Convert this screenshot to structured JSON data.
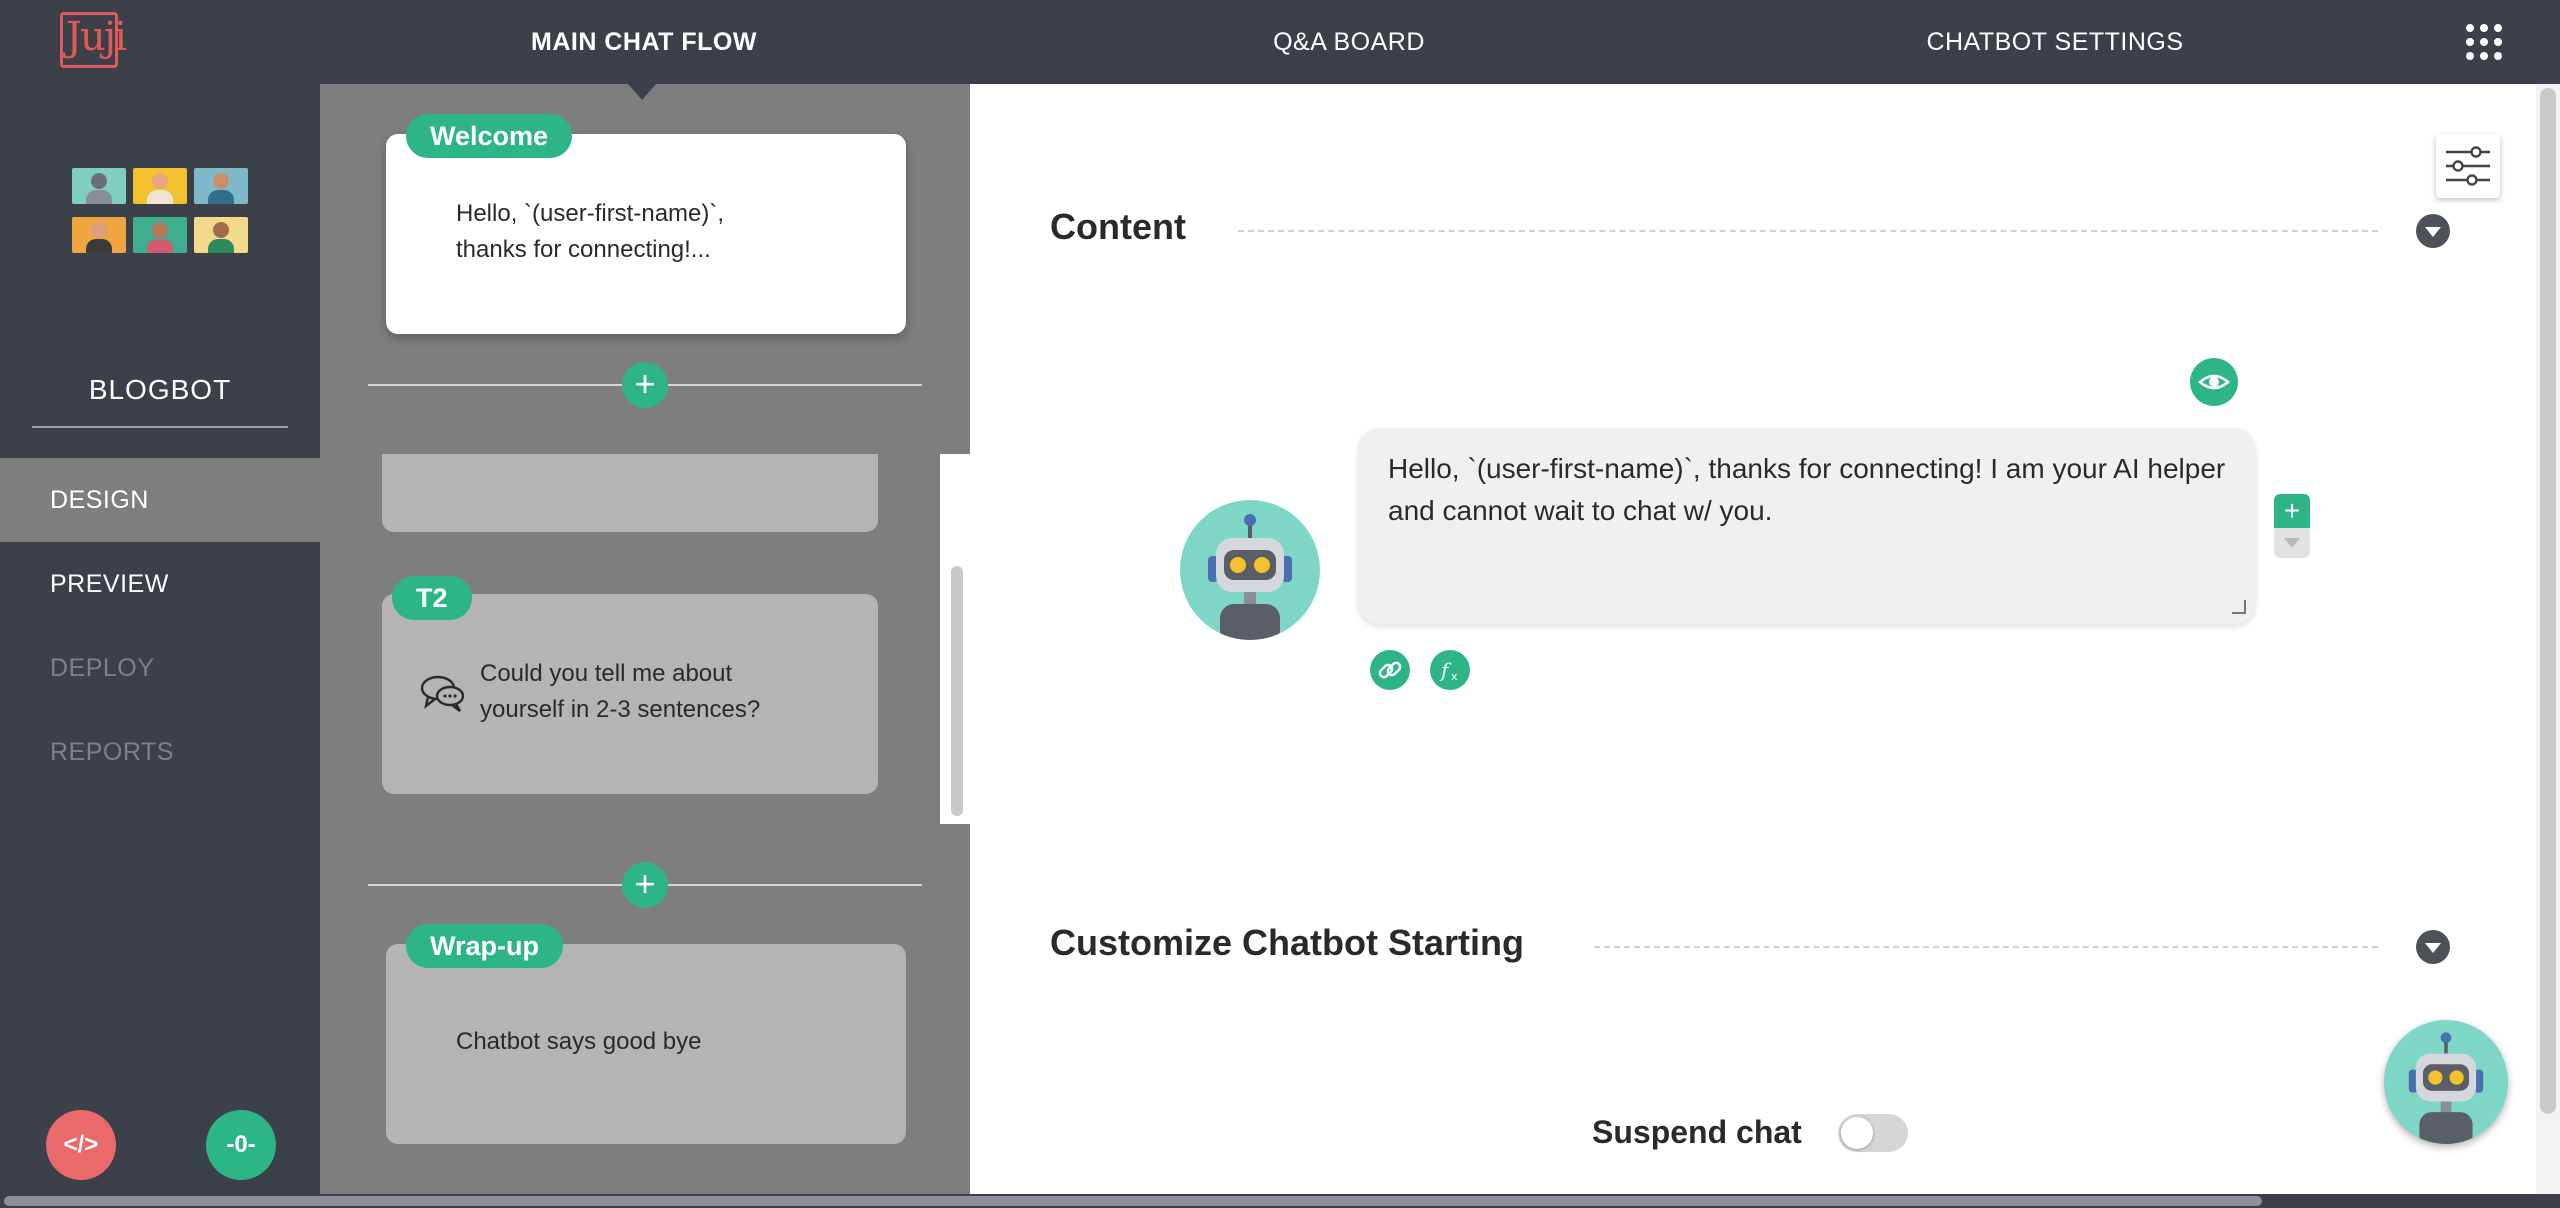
{
  "app": {
    "logo_text": "Juji"
  },
  "topnav": {
    "items": [
      {
        "label": "MAIN CHAT FLOW",
        "active": true
      },
      {
        "label": "Q&A BOARD",
        "active": false
      },
      {
        "label": "CHATBOT SETTINGS",
        "active": false
      }
    ],
    "apps_icon": "grid-dots-icon"
  },
  "sidebar": {
    "bot_name": "BLOGBOT",
    "items": [
      {
        "label": "DESIGN",
        "state": "active"
      },
      {
        "label": "PREVIEW",
        "state": "normal"
      },
      {
        "label": "DEPLOY",
        "state": "disabled"
      },
      {
        "label": "REPORTS",
        "state": "disabled"
      }
    ],
    "code_button": "</>",
    "counter_button": "-0-"
  },
  "flow": {
    "cards": [
      {
        "tag": "Welcome",
        "text": "Hello, `(user-first-name)`,\nthanks for connecting!..."
      },
      {
        "tag": "T2",
        "text": "Could you tell me about\nyourself in 2-3 sentences?",
        "icon": "chat-bubbles-icon"
      },
      {
        "tag": "Wrap-up",
        "text": "Chatbot says good bye"
      }
    ],
    "add_label": "+"
  },
  "editor": {
    "content_title": "Content",
    "message": "Hello, `(user-first-name)`, thanks for connecting! I am your AI helper and cannot wait to chat w/ you.",
    "add_label": "+",
    "customize_title": "Customize Chatbot Starting",
    "suspend_label": "Suspend chat",
    "suspend_on": false
  },
  "colors": {
    "topbar": "#3c4149",
    "accent_green": "#2eb586",
    "accent_red": "#e96a6a",
    "flow_bg": "#7e7e7e"
  }
}
